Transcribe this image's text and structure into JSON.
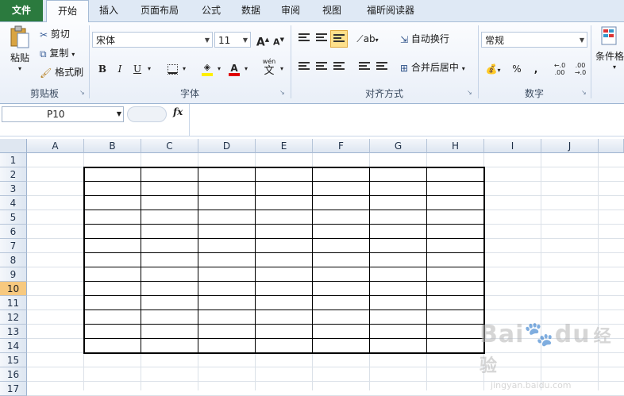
{
  "tabs": [
    "文件",
    "开始",
    "插入",
    "页面布局",
    "公式",
    "数据",
    "审阅",
    "视图",
    "福昕阅读器"
  ],
  "clipboard": {
    "paste": "粘贴",
    "cut": "剪切",
    "copy": "复制",
    "format_painter": "格式刷",
    "group_label": "剪贴板"
  },
  "font": {
    "name": "宋体",
    "size": "11",
    "bold": "B",
    "italic": "I",
    "underline": "U",
    "grow": "A",
    "shrink": "A",
    "font_color_letter": "A",
    "phonetic": "wén",
    "phonetic_char": "文",
    "group_label": "字体"
  },
  "alignment": {
    "wrap_text": "自动换行",
    "merge_center": "合并后居中",
    "group_label": "对齐方式"
  },
  "number": {
    "format": "常规",
    "percent": "%",
    "comma": ",",
    "inc_decimal": "←.0 .00",
    "dec_decimal": ".00 →.0",
    "group_label": "数字"
  },
  "styles": {
    "conditional_format": "条件格"
  },
  "formula_bar": {
    "name_box": "P10",
    "fx": "fx"
  },
  "columns": [
    "A",
    "B",
    "C",
    "D",
    "E",
    "F",
    "G",
    "H",
    "I",
    "J"
  ],
  "rows": [
    "1",
    "2",
    "3",
    "4",
    "5",
    "6",
    "7",
    "8",
    "9",
    "10",
    "11",
    "12",
    "13",
    "14",
    "15",
    "16",
    "17"
  ],
  "selected_row": "10",
  "watermark": {
    "brand": "Bai",
    "brand2": "du",
    "cn": "经验",
    "url": "jingyan.baidu.com"
  },
  "colors": {
    "file_tab": "#2b7a3e",
    "header_bg": "#dde6f1",
    "selected_row_bg": "#f7c97f"
  }
}
